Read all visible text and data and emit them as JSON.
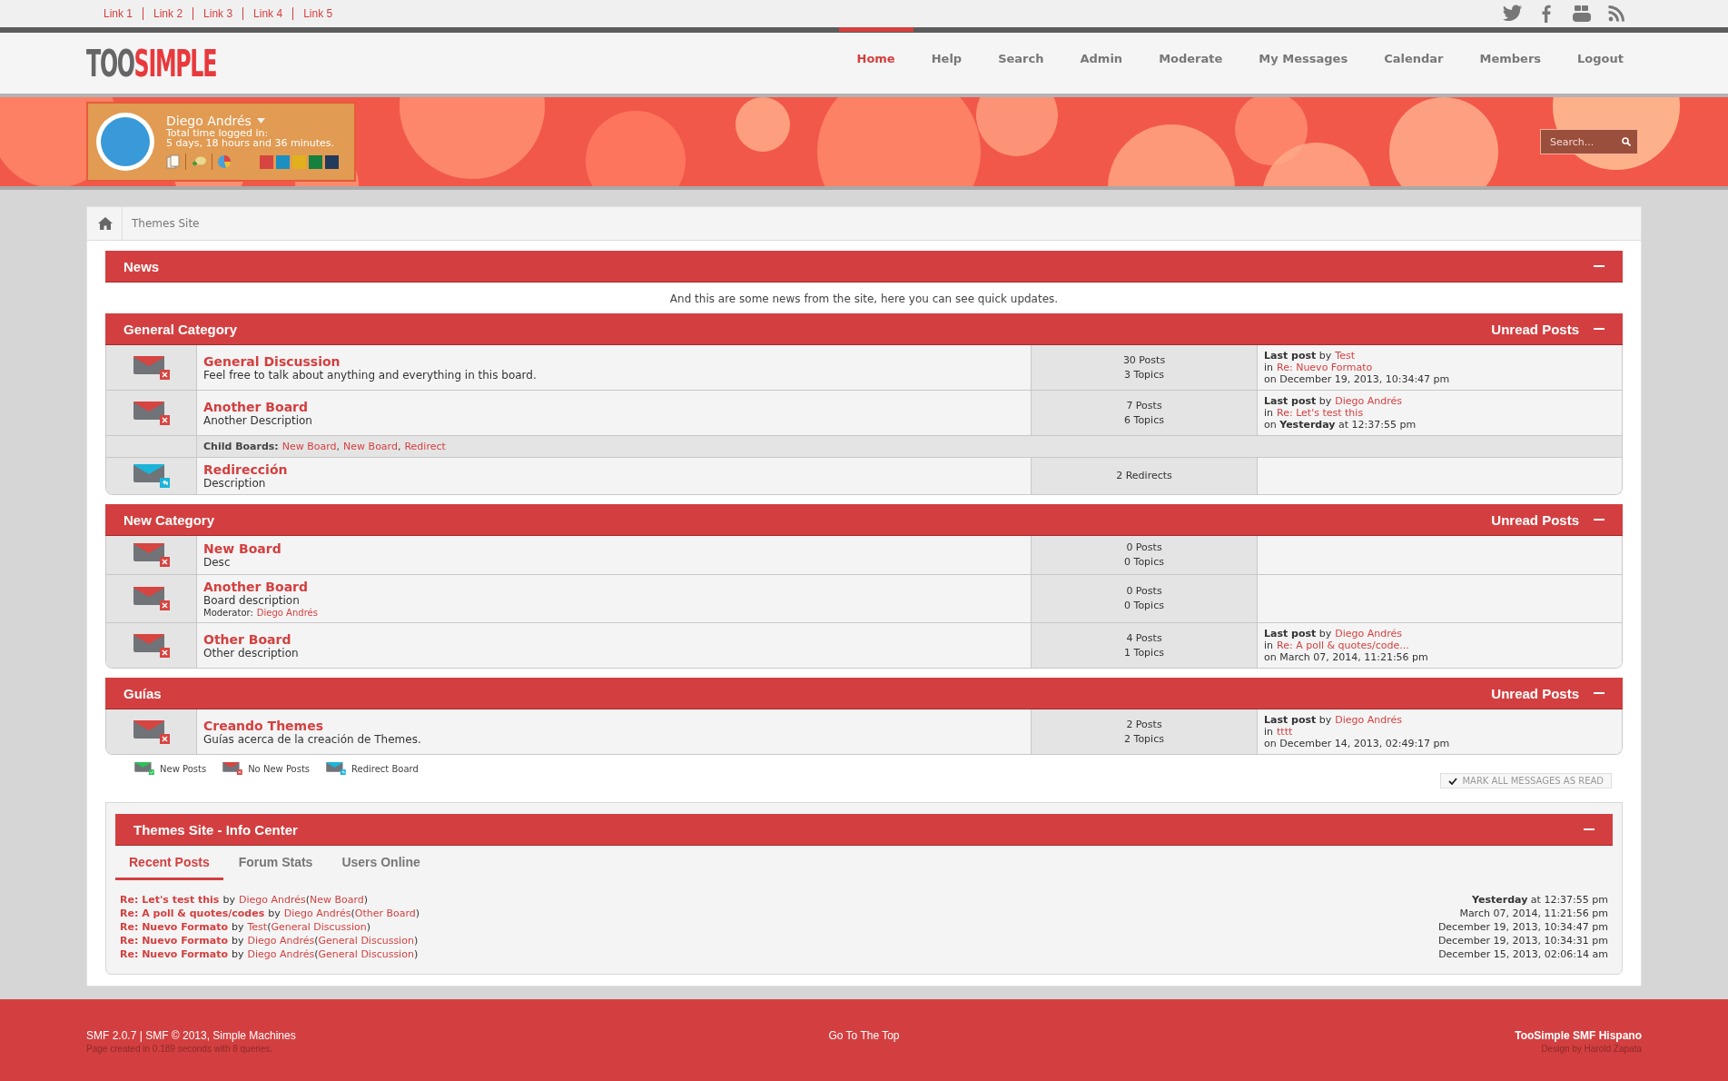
{
  "top_links": [
    "Link 1",
    "Link 2",
    "Link 3",
    "Link 4",
    "Link 5"
  ],
  "social": [
    {
      "kind": "twitter"
    },
    {
      "kind": "facebook"
    },
    {
      "kind": "youtube"
    },
    {
      "kind": "rss"
    }
  ],
  "logo": {
    "first": "TOO",
    "second": "SIMPLE"
  },
  "nav": [
    {
      "label": "Home",
      "selected": true
    },
    {
      "label": "Help",
      "selected": false
    },
    {
      "label": "Search",
      "selected": false
    },
    {
      "label": "Admin",
      "selected": false
    },
    {
      "label": "Moderate",
      "selected": false
    },
    {
      "label": "My Messages",
      "selected": false
    },
    {
      "label": "Calendar",
      "selected": false
    },
    {
      "label": "Members",
      "selected": false
    },
    {
      "label": "Logout",
      "selected": false
    }
  ],
  "user": {
    "name": "Diego Andrés",
    "time_label": "Total time logged in:",
    "time_value": "5 days, 18 hours and 36 minutes.",
    "swatches": [
      {
        "color": "#d64541"
      },
      {
        "color": "#1b8fc0"
      },
      {
        "color": "#e0b11c"
      },
      {
        "color": "#17803f"
      },
      {
        "color": "#243a5c"
      }
    ]
  },
  "search": {
    "placeholder": "Search..."
  },
  "breadcrumb": [
    "Themes Site"
  ],
  "news": {
    "title": "News",
    "text": "And this are some news from the site, here you can see quick updates."
  },
  "categories": [
    {
      "title": "General Category",
      "unread": "Unread Posts",
      "boards": [
        {
          "kind": "no_new",
          "name": "General Discussion",
          "description": "Feel free to talk about anything and everything in this board.",
          "stats": [
            "30 Posts",
            "3 Topics"
          ],
          "last_post": {
            "prefix": "**Last post** by",
            "author": "Test",
            "in": "in",
            "topic": "Re: Nuevo Formato",
            "time": "on December 19, 2013, 10:34:47 pm"
          }
        },
        {
          "kind": "no_new",
          "name": "Another Board",
          "description": "Another Description",
          "stats": [
            "7 Posts",
            "6 Topics"
          ],
          "last_post": {
            "prefix": "**Last post** by",
            "author": "Diego Andrés",
            "in": "in",
            "topic": "Re: Let's test this",
            "time": "on **Yesterday** at 12:37:55 pm"
          },
          "child_boards": {
            "label": "Child Boards:",
            "links": [
              {
                "name": "New Board",
                "sep": ","
              },
              {
                "name": "New Board",
                "sep": ","
              },
              {
                "name": "Redirect"
              }
            ]
          }
        },
        {
          "kind": "redirect",
          "name": "Redirección",
          "description": "Description",
          "stats": [
            "2 Redirects"
          ]
        }
      ]
    },
    {
      "title": "New Category",
      "unread": "Unread Posts",
      "boards": [
        {
          "kind": "no_new",
          "name": "New Board",
          "description": "Desc",
          "stats": [
            "0 Posts",
            "0 Topics"
          ]
        },
        {
          "kind": "no_new",
          "name": "Another Board",
          "description": "Board description",
          "moderator": {
            "label": "Moderator:",
            "name": "Diego Andrés"
          },
          "stats": [
            "0 Posts",
            "0 Topics"
          ]
        },
        {
          "kind": "no_new",
          "name": "Other Board",
          "description": "Other description",
          "stats": [
            "4 Posts",
            "1 Topics"
          ],
          "last_post": {
            "prefix": "**Last post** by",
            "author": "Diego Andrés",
            "in": "in",
            "topic": "Re: A poll & quotes/code...",
            "time": "on March 07, 2014, 11:21:56 pm"
          }
        }
      ]
    },
    {
      "title": "Guías",
      "unread": "Unread Posts",
      "boards": [
        {
          "kind": "no_new",
          "name": "Creando Themes",
          "description": "Guías acerca de la creación de Themes.",
          "stats": [
            "2 Posts",
            "2 Topics"
          ],
          "last_post": {
            "prefix": "**Last post** by",
            "author": "Diego Andrés",
            "in": "in",
            "topic": "tttt",
            "time": "on December 14, 2013, 02:49:17 pm"
          }
        }
      ]
    }
  ],
  "legend": [
    {
      "kind": "new",
      "label": "New Posts"
    },
    {
      "kind": "no_new",
      "label": "No New Posts"
    },
    {
      "kind": "redirect",
      "label": "Redirect Board"
    }
  ],
  "mark_read": "MARK ALL MESSAGES AS READ",
  "info_center": {
    "title": "Themes Site - Info Center",
    "tabs": [
      {
        "label": "Recent Posts",
        "selected": true
      },
      {
        "label": "Forum Stats",
        "selected": false
      },
      {
        "label": "Users Online",
        "selected": false
      }
    ],
    "recent_posts": [
      {
        "subject": "Re: Let's test this",
        "by": "by",
        "author": "Diego Andrés",
        "open": "(",
        "board": "New Board",
        "close": ")",
        "time": "**Yesterday** at 12:37:55 pm"
      },
      {
        "subject": "Re: A poll & quotes/codes",
        "by": "by",
        "author": "Diego Andrés",
        "open": "(",
        "board": "Other Board",
        "close": ")",
        "time": "March 07, 2014, 11:21:56 pm"
      },
      {
        "subject": "Re: Nuevo Formato",
        "by": "by",
        "author": "Test",
        "open": "(",
        "board": "General Discussion",
        "close": ")",
        "time": "December 19, 2013, 10:34:47 pm"
      },
      {
        "subject": "Re: Nuevo Formato",
        "by": "by",
        "author": "Diego Andrés",
        "open": "(",
        "board": "General Discussion",
        "close": ")",
        "time": "December 19, 2013, 10:34:31 pm"
      },
      {
        "subject": "Re: Nuevo Formato",
        "by": "by",
        "author": "Diego Andrés",
        "open": "(",
        "board": "General Discussion",
        "close": ")",
        "time": "December 15, 2013, 02:06:14 am"
      }
    ]
  },
  "footer": {
    "copyright": "SMF 2.0.7 | SMF © 2013, Simple Machines",
    "page_time": "Page created in 0.189 seconds with 8 queries.",
    "top": "Go To The Top",
    "theme": "TooSimple SMF Hispano",
    "designer": "Design by Harold Zapata"
  }
}
